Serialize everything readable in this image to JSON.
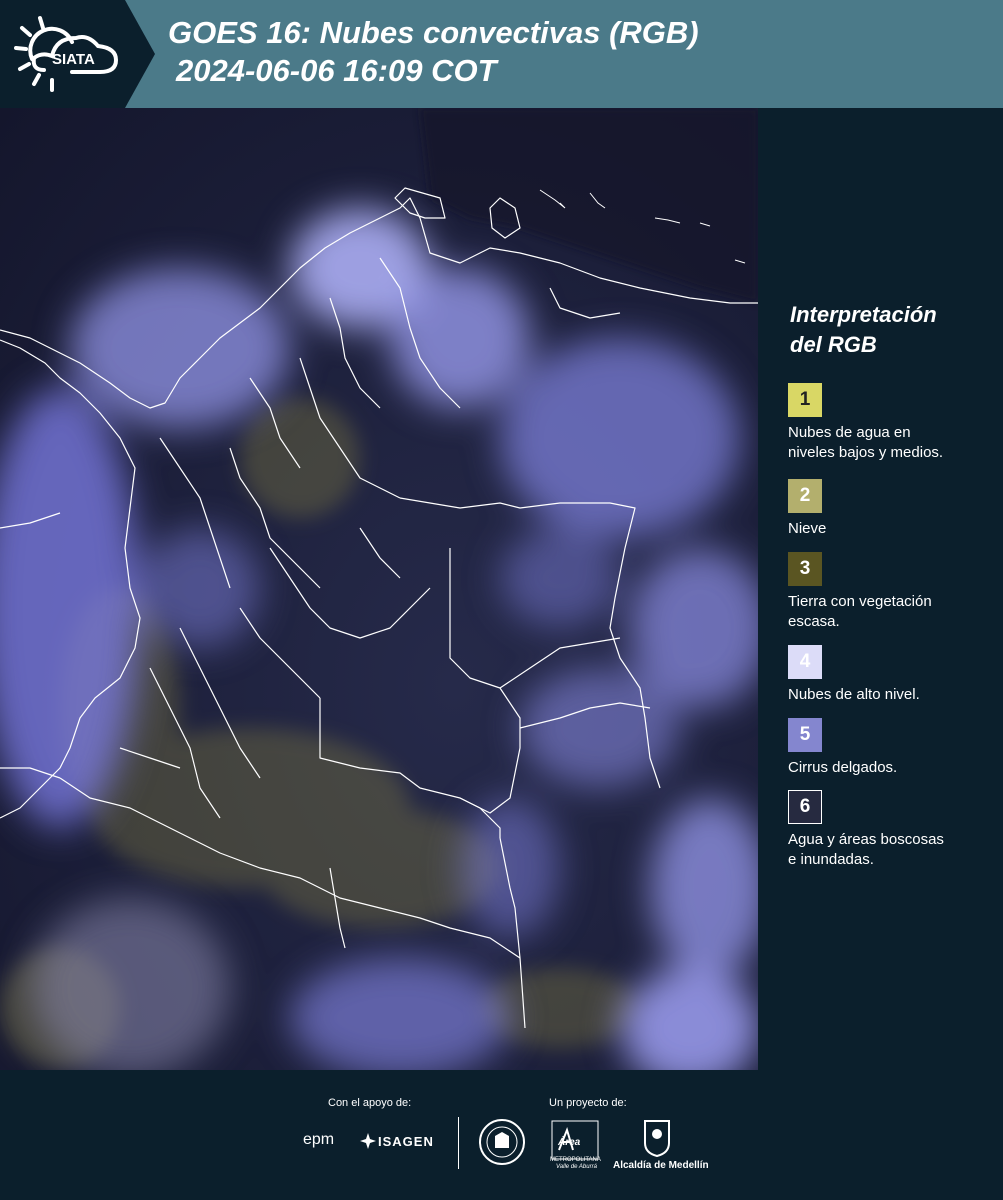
{
  "header": {
    "logo_text": "SIATA",
    "title_line1": "GOES 16: Nubes convectivas (RGB)",
    "title_line2": "2024-06-06 16:09 COT"
  },
  "legend": {
    "title_line1": "Interpretación",
    "title_line2": "del RGB",
    "items": [
      {
        "number": "1",
        "color": "#d9d765",
        "text_color": "#222222",
        "label_line1": "Nubes de agua en",
        "label_line2": "niveles bajos y medios."
      },
      {
        "number": "2",
        "color": "#b3af6d",
        "text_color": "#ffffff",
        "label_line1": "Nieve",
        "label_line2": ""
      },
      {
        "number": "3",
        "color": "#5a5522",
        "text_color": "#ffffff",
        "label_line1": "Tierra con vegetación",
        "label_line2": "escasa."
      },
      {
        "number": "4",
        "color": "#dcdcf8",
        "text_color": "#ffffff",
        "label_line1": "Nubes de alto nivel.",
        "label_line2": ""
      },
      {
        "number": "5",
        "color": "#8486cf",
        "text_color": "#ffffff",
        "label_line1": "Cirrus delgados.",
        "label_line2": ""
      },
      {
        "number": "6",
        "color": "#262a40",
        "text_color": "#ffffff",
        "label_line1": "Agua y áreas boscosas",
        "label_line2": "e inundadas."
      }
    ]
  },
  "footer": {
    "support_label": "Con el apoyo de:",
    "project_label": "Un proyecto de:",
    "sponsors": [
      "epm",
      "ISAGEN"
    ],
    "partners": {
      "metropolitana_top": "Área",
      "metropolitana_line1": "METROPOLITANA",
      "metropolitana_line2": "Valle de Aburrá",
      "alcaldia": "Alcaldía de Medellín"
    }
  }
}
